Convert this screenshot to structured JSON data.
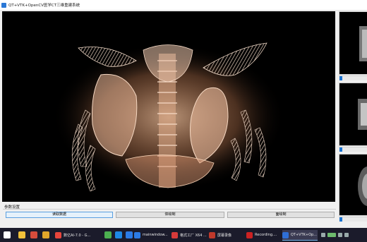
{
  "window": {
    "title": "QT+VTK+OpenCV医学CT三维重建系统"
  },
  "viewport": {
    "background": "#000000",
    "render_color": "#f0c2a2"
  },
  "params": {
    "section_label": "参数设置",
    "buttons": [
      {
        "label": "读取数据",
        "active": true
      },
      {
        "label": "体绘制",
        "active": false
      },
      {
        "label": "面绘制",
        "active": false
      }
    ]
  },
  "taskbar": {
    "items": [
      {
        "label": "数亿AI-7.0 - G...",
        "icon_color": "#e8453c",
        "icon": "browser-icon"
      },
      {
        "label": "mainwindow...",
        "icon_color": "#2c7be5",
        "icon": "edge-icon"
      },
      {
        "label": "格式工厂 X64 ...",
        "icon_color": "#d63a3a",
        "icon": "format-factory-icon"
      },
      {
        "label": "屏幕录像",
        "icon_color": "#c0392b",
        "icon": "recorder-icon"
      },
      {
        "label": "Recording....",
        "icon_color": "#cc2222",
        "icon": "recording-icon"
      },
      {
        "label": "QT+VTK+Op...",
        "icon_color": "#2f6fd6",
        "icon": "qt-app-icon"
      }
    ],
    "pinned_icons": [
      "start-icon",
      "file-icon",
      "qt-icon",
      "chrome-icon",
      "tool-icon",
      "edge-icon",
      "app-icon"
    ]
  }
}
